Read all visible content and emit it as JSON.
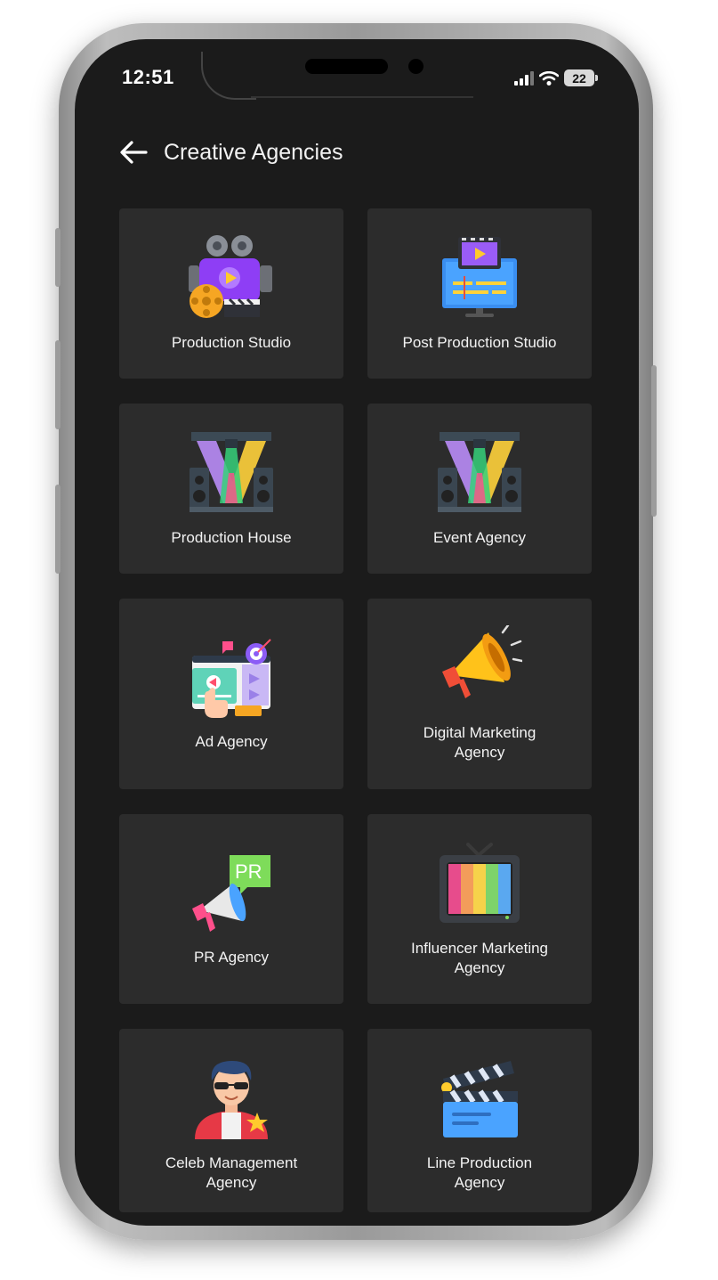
{
  "status_bar": {
    "time": "12:51",
    "battery": "22"
  },
  "header": {
    "title": "Creative Agencies"
  },
  "agencies": [
    {
      "label": "Production  Studio",
      "icon": "film-camera-icon"
    },
    {
      "label": "Post Production Studio",
      "icon": "video-editing-monitor-icon"
    },
    {
      "label": "Production House",
      "icon": "stage-lights-icon"
    },
    {
      "label": "Event Agency",
      "icon": "stage-lights-icon"
    },
    {
      "label": "Ad Agency",
      "icon": "ad-campaign-icon"
    },
    {
      "label": "Digital Marketing\nAgency",
      "icon": "megaphone-icon"
    },
    {
      "label": "PR Agency",
      "icon": "pr-megaphone-icon"
    },
    {
      "label": "Influencer Marketing\nAgency",
      "icon": "retro-tv-icon"
    },
    {
      "label": "Celeb Management\nAgency",
      "icon": "celebrity-icon"
    },
    {
      "label": "Line Production\nAgency",
      "icon": "clapperboard-icon"
    }
  ]
}
